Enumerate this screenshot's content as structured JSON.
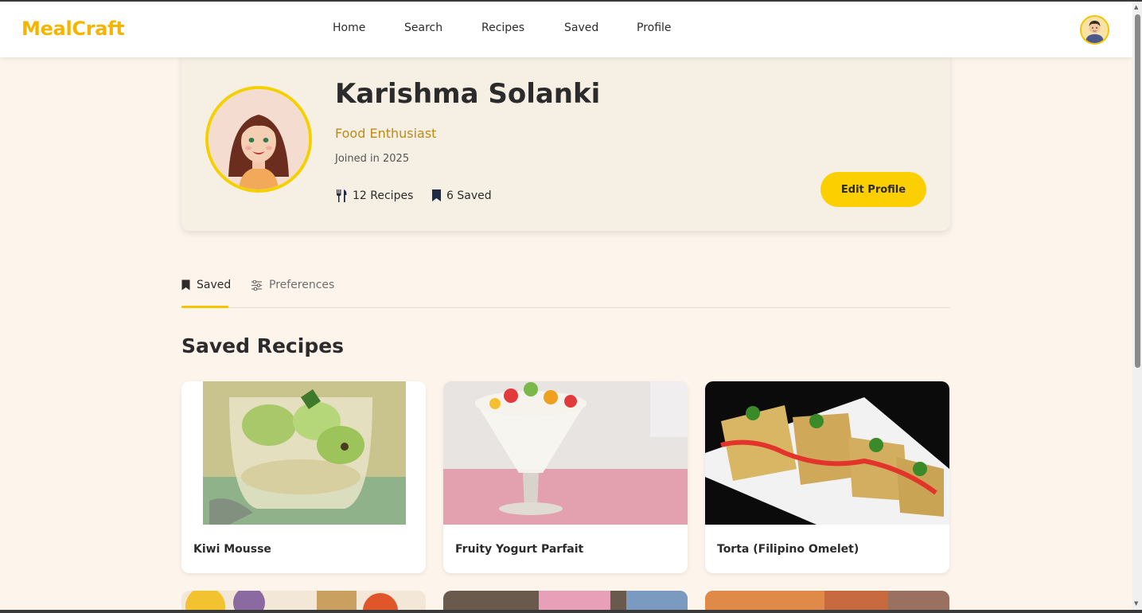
{
  "nav": {
    "brand": "MealCraft",
    "links": [
      "Home",
      "Search",
      "Recipes",
      "Saved",
      "Profile"
    ],
    "avatar_icon": "user-avatar-icon"
  },
  "profile": {
    "name": "Karishma Solanki",
    "role": "Food Enthusiast",
    "joined": "Joined in 2025",
    "recipes_stat": "12 Recipes",
    "saved_stat": "6 Saved",
    "edit_label": "Edit Profile"
  },
  "tabs": {
    "saved": "Saved",
    "preferences": "Preferences"
  },
  "section_title": "Saved Recipes",
  "recipes": [
    {
      "title": "Kiwi Mousse"
    },
    {
      "title": "Fruity Yogurt Parfait"
    },
    {
      "title": "Torta (Filipino Omelet)"
    }
  ],
  "colors": {
    "accent": "#f5b400",
    "button": "#fcd000",
    "background": "#fdf5ec",
    "card": "#f6efe4"
  }
}
